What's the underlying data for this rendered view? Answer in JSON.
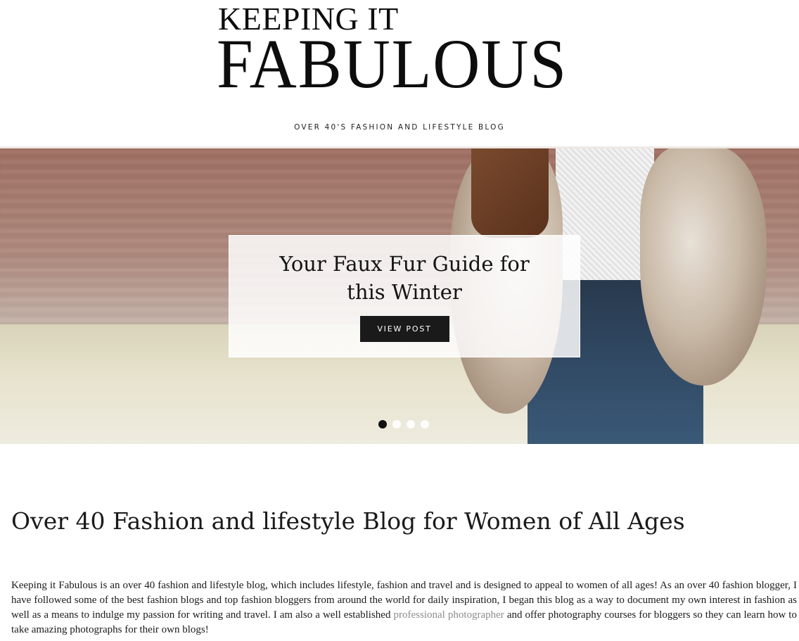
{
  "site": {
    "logo_line1": "KEEPING IT",
    "logo_line2": "FABULOUS",
    "tagline": "OVER 40'S FASHION AND LIFESTYLE BLOG"
  },
  "hero": {
    "slide_title": "Your Faux Fur Guide for this Winter",
    "button_label": "VIEW POST",
    "slide_count": 4,
    "active_slide": 1
  },
  "intro": {
    "heading": "Over 40 Fashion and lifestyle Blog for Women of All Ages",
    "text_part1": "Keeping it Fabulous is an over 40 fashion and lifestyle blog, which  includes lifestyle, fashion and travel and is designed to appeal to women of all ages! As an over 40 fashion blogger, I have followed some of the best fashion blogs and top fashion bloggers from around the world for daily inspiration, I began this blog as a way to document my own interest in fashion as well as a means to indulge my passion for writing and travel. I am also a well established ",
    "link_text": "professional photographer",
    "text_part2": " and offer photography courses for bloggers so they can learn how to take amazing photographs for their own blogs!"
  },
  "colors": {
    "accent_dark": "#1a1a1a",
    "link_gray": "#8c8c8c",
    "divider": "#efe9e6"
  }
}
